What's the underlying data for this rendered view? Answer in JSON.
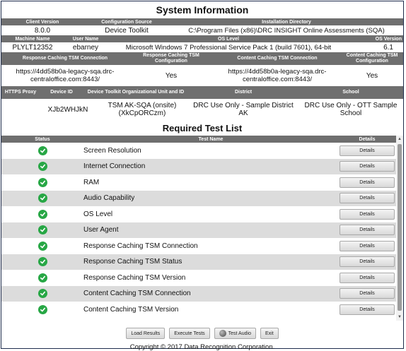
{
  "title": "System Information",
  "sysinfo": {
    "row1_headers": [
      "Client Version",
      "Configuration Source",
      "Installation Directory"
    ],
    "row1_values": [
      "8.0.0",
      "Device Toolkit",
      "C:\\Program Files (x86)\\DRC INSIGHT Online Assessments (SQA)"
    ],
    "row2_headers": [
      "Machine Name",
      "User Name",
      "OS Level",
      "OS Version"
    ],
    "row2_values": [
      "PLYLT12352",
      "ebarney",
      "Microsoft Windows 7 Professional Service Pack 1 (build 7601), 64-bit",
      "6.1"
    ],
    "row3_headers": [
      "Response Caching TSM Connection",
      "Response Caching TSM Configuration",
      "Content Caching TSM Connection",
      "Content Caching TSM Configuration"
    ],
    "row3_values": [
      "https://4dd58b0a-legacy-sqa.drc-centraloffice.com:8443/",
      "Yes",
      "https://4dd58b0a-legacy-sqa.drc-centraloffice.com:8443/",
      "Yes"
    ],
    "row4_headers": [
      "HTTPS Proxy",
      "Device ID",
      "Device Toolkit Organizational Unit and ID",
      "District",
      "School"
    ],
    "row4_values": [
      "",
      "XJb2WHJkN",
      "TSM AK-SQA (onsite) (XkCpORCzm)",
      "DRC Use Only - Sample District AK",
      "DRC Use Only - OTT Sample School"
    ]
  },
  "tests": {
    "title": "Required Test List",
    "headers": {
      "status": "Status",
      "name": "Test Name",
      "details": "Details"
    },
    "details_label": "Details",
    "status_icon": "check-circle-icon",
    "status_color": "#27a745",
    "items": [
      {
        "name": "Screen Resolution"
      },
      {
        "name": "Internet Connection"
      },
      {
        "name": "RAM"
      },
      {
        "name": "Audio Capability"
      },
      {
        "name": "OS Level"
      },
      {
        "name": "User Agent"
      },
      {
        "name": "Response Caching TSM Connection"
      },
      {
        "name": "Response Caching TSM Status"
      },
      {
        "name": "Response Caching TSM Version"
      },
      {
        "name": "Content Caching TSM Connection"
      },
      {
        "name": "Content Caching TSM Version"
      }
    ]
  },
  "buttons": {
    "load_results": "Load Results",
    "execute_tests": "Execute Tests",
    "test_audio": "Test Audio",
    "exit": "Exit"
  },
  "footer": {
    "copyright": "Copyright © 2017 Data Recognition Corporation."
  }
}
